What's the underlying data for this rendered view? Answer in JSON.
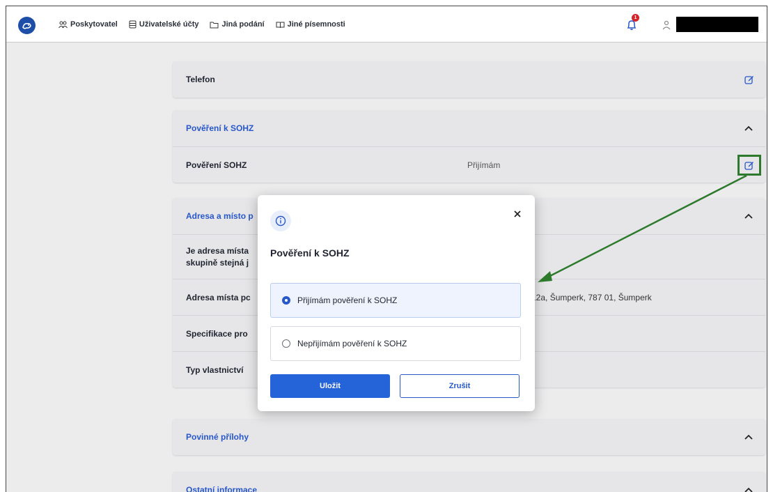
{
  "nav": {
    "items": [
      {
        "label": "Poskytovatel",
        "icon": "users-icon"
      },
      {
        "label": "Uživatelské účty",
        "icon": "database-icon"
      },
      {
        "label": "Jiná podání",
        "icon": "folder-icon"
      },
      {
        "label": "Jiné písemnosti",
        "icon": "book-icon"
      }
    ],
    "notification_count": "1"
  },
  "cards": {
    "telefon": "Telefon",
    "poverenik_header": "Pověření k SOHZ",
    "povereni_label": "Pověření SOHZ",
    "povereni_value": "Přijímám",
    "adresa_header": "Adresa a místo p",
    "adresa_row1": "Je adresa místa",
    "adresa_row1b": "skupině stejná j",
    "adresa_row2": "Adresa místa pc",
    "adresa_row2_value": "9/12a, Šumperk, 787 01, Šumperk",
    "adresa_row3": "Specifikace pro",
    "adresa_row4": "Typ vlastnictví",
    "prilohy_header": "Povinné přílohy",
    "ostatni_header": "Ostatní informace"
  },
  "modal": {
    "title": "Pověření k SOHZ",
    "option_accept": "Přijímám pověření k SOHZ",
    "option_decline": "Nepřijímám pověření k SOHZ",
    "save_label": "Uložit",
    "cancel_label": "Zrušit"
  },
  "colors": {
    "accent": "#2757c9",
    "annotation": "#2d7a2d",
    "badge": "#d4232a"
  }
}
